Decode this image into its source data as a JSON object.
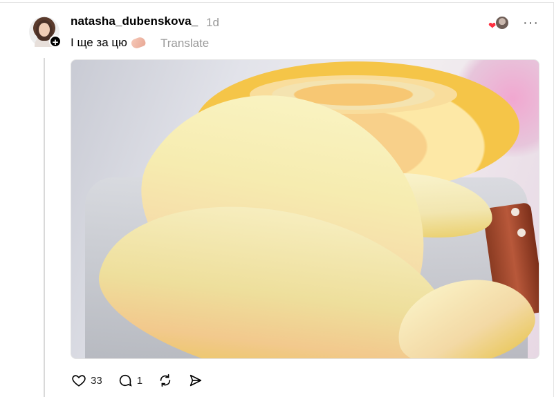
{
  "post": {
    "username": "natasha_dubenskova_",
    "timestamp": "1d",
    "caption": "І ще за цю",
    "translate_label": "Translate",
    "follow_symbol": "+",
    "more_symbol": "···",
    "heart_symbol": "❤"
  },
  "actions": {
    "like_count": "33",
    "reply_count": "1"
  },
  "icons": {
    "avatar": "profile-photo",
    "like": "heart-outline-icon",
    "reply": "speech-bubble-icon",
    "repost": "repost-icon",
    "share": "paper-plane-icon",
    "caption_emoji": "hand-emoji"
  },
  "colors": {
    "accent_heart": "#ff3040",
    "muted_text": "#999999",
    "thread_line": "#d9d9d9"
  }
}
